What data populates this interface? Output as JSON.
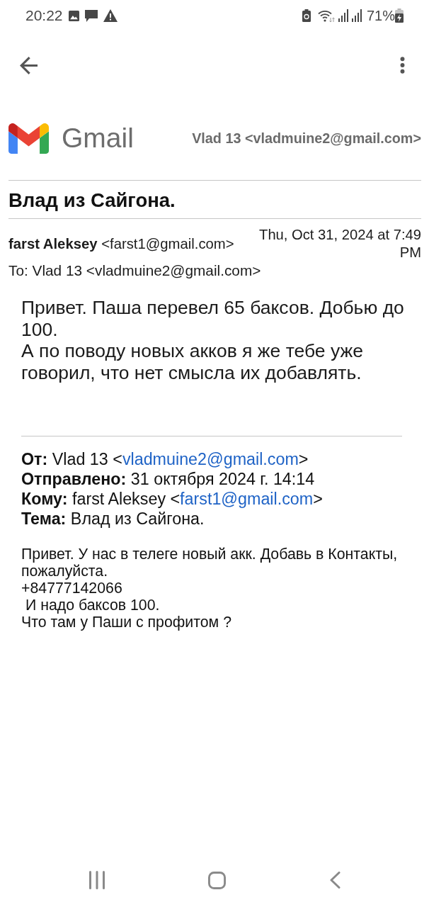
{
  "status_bar": {
    "time": "20:22",
    "battery": "71%"
  },
  "print_header": {
    "logo_text": "Gmail",
    "account": "Vlad 13 <vladmuine2@gmail.com>"
  },
  "subject": "Влад из Сайгона.",
  "message": {
    "sender_name": "farst Aleksey",
    "sender_email": "<farst1@gmail.com>",
    "date": "Thu, Oct 31, 2024 at 7:49 PM",
    "to": "To: Vlad 13 <vladmuine2@gmail.com>",
    "body": [
      "Привет. Паша перевел 65 баксов. Добью до 100.",
      "А по поводу новых акков я же тебе уже говорил, что нет смысла их добавлять."
    ]
  },
  "quoted": {
    "headers": [
      {
        "label": "От:",
        "value": "Vlad 13 <",
        "link": "vladmuine2@gmail.com",
        "after": ">"
      },
      {
        "label": "Отправлено:",
        "value": "31 октября 2024 г. 14:14"
      },
      {
        "label": "Кому:",
        "value": "farst Aleksey <",
        "link": "farst1@gmail.com",
        "after": ">"
      },
      {
        "label": "Тема:",
        "value": "Влад из Сайгона."
      }
    ],
    "body": [
      "Привет. У нас в телеге новый акк. Добавь в Контакты, пожалуйста.",
      "+84777142066",
      " И надо баксов 100.",
      "Что там у Паши с профитом ?"
    ]
  }
}
